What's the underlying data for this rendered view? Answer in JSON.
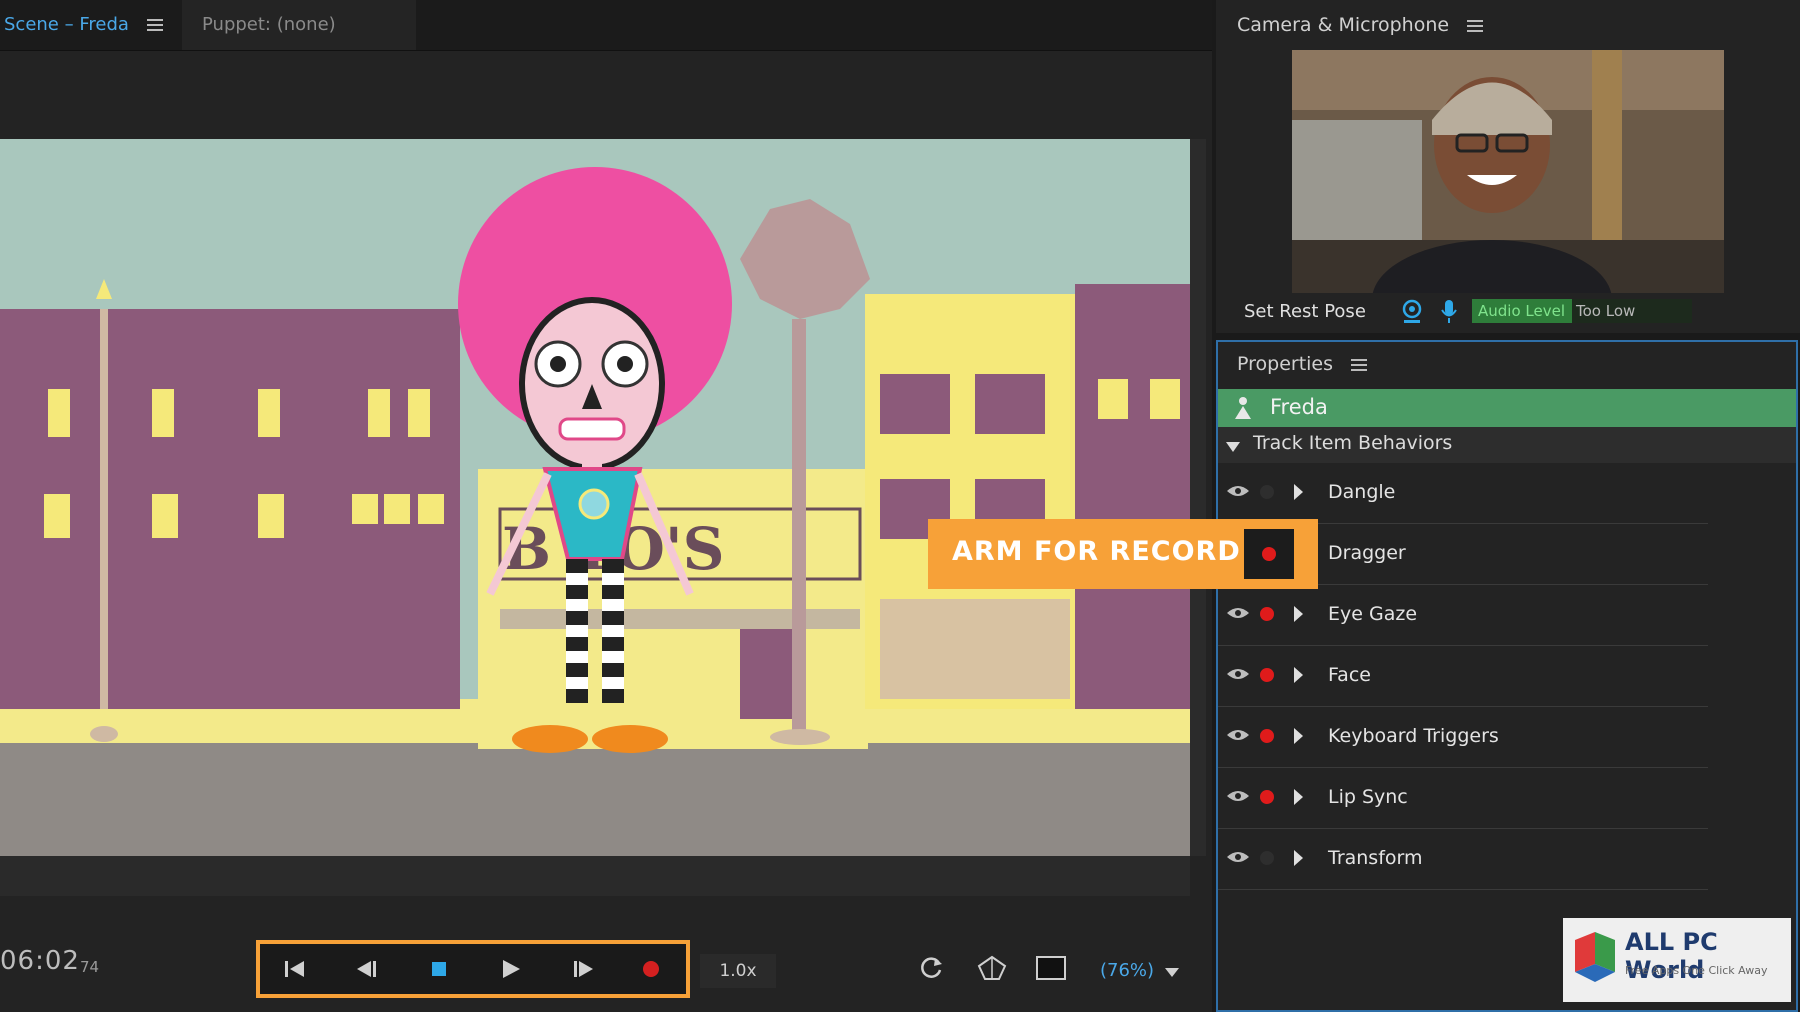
{
  "scene_panel": {
    "tabs": [
      {
        "label": "Scene – Freda",
        "active": true
      },
      {
        "label": "Puppet: (none)",
        "active": false
      }
    ],
    "sign_text": "B   TO'S",
    "timecode": "06:02",
    "frame": "74",
    "speed": "1.0x",
    "zoom": "(76%)",
    "transport_buttons": [
      "go-to-start",
      "step-back",
      "stop",
      "play",
      "step-forward",
      "record"
    ]
  },
  "camera_panel": {
    "title": "Camera & Microphone",
    "set_rest_pose": "Set Rest Pose",
    "audio_label": "Audio Level",
    "audio_value": "Too Low"
  },
  "properties_panel": {
    "title": "Properties",
    "puppet_name": "Freda",
    "section": "Track Item Behaviors",
    "behaviors": [
      {
        "label": "Dangle",
        "visible": true,
        "armed": false
      },
      {
        "label": "Dragger",
        "visible": false,
        "armed": true
      },
      {
        "label": "Eye Gaze",
        "visible": true,
        "armed": true
      },
      {
        "label": "Face",
        "visible": true,
        "armed": true
      },
      {
        "label": "Keyboard Triggers",
        "visible": true,
        "armed": true
      },
      {
        "label": "Lip Sync",
        "visible": true,
        "armed": true
      },
      {
        "label": "Transform",
        "visible": true,
        "armed": false
      }
    ]
  },
  "callout": {
    "text": "ARM FOR RECORD"
  },
  "watermark": {
    "title": "ALL PC World",
    "subtitle": "Free Apps One Click Away"
  },
  "colors": {
    "accent": "#f7a138",
    "link_blue": "#4aa8e8",
    "armed_red": "#e01b1b",
    "puppet_green": "#4a9a64"
  }
}
